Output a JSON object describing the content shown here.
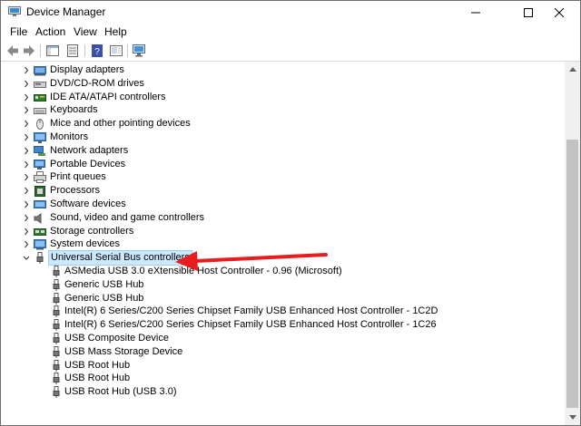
{
  "window": {
    "title": "Device Manager"
  },
  "menu": [
    "File",
    "Action",
    "View",
    "Help"
  ],
  "toolbar": [
    "back-icon",
    "forward-icon",
    "show-hide-tree-icon",
    "properties-icon",
    "help-icon",
    "update-driver-icon",
    "scan-hardware-icon"
  ],
  "tree": {
    "categories": [
      {
        "label": "Display adapters",
        "icon": "display-adapter-icon"
      },
      {
        "label": "DVD/CD-ROM drives",
        "icon": "dvd-drive-icon"
      },
      {
        "label": "IDE ATA/ATAPI controllers",
        "icon": "ide-controller-icon"
      },
      {
        "label": "Keyboards",
        "icon": "keyboard-icon"
      },
      {
        "label": "Mice and other pointing devices",
        "icon": "mouse-icon"
      },
      {
        "label": "Monitors",
        "icon": "monitor-icon"
      },
      {
        "label": "Network adapters",
        "icon": "network-adapter-icon"
      },
      {
        "label": "Portable Devices",
        "icon": "portable-device-icon"
      },
      {
        "label": "Print queues",
        "icon": "printer-icon"
      },
      {
        "label": "Processors",
        "icon": "processor-icon"
      },
      {
        "label": "Software devices",
        "icon": "software-device-icon"
      },
      {
        "label": "Sound, video and game controllers",
        "icon": "speaker-icon"
      },
      {
        "label": "Storage controllers",
        "icon": "storage-controller-icon"
      },
      {
        "label": "System devices",
        "icon": "system-device-icon"
      }
    ],
    "expanded": {
      "label": "Universal Serial Bus controllers",
      "icon": "usb-icon",
      "children": [
        "ASMedia USB 3.0 eXtensible Host Controller - 0.96 (Microsoft)",
        "Generic USB Hub",
        "Generic USB Hub",
        "Intel(R) 6 Series/C200 Series Chipset Family USB Enhanced Host Controller - 1C2D",
        "Intel(R) 6 Series/C200 Series Chipset Family USB Enhanced Host Controller - 1C26",
        "USB Composite Device",
        "USB Mass Storage Device",
        "USB Root Hub",
        "USB Root Hub",
        "USB Root Hub (USB 3.0)"
      ]
    }
  },
  "colors": {
    "selection": "#cce8ff",
    "selection_border": "#99d1ff",
    "annotation_arrow": "#e81e1e"
  }
}
